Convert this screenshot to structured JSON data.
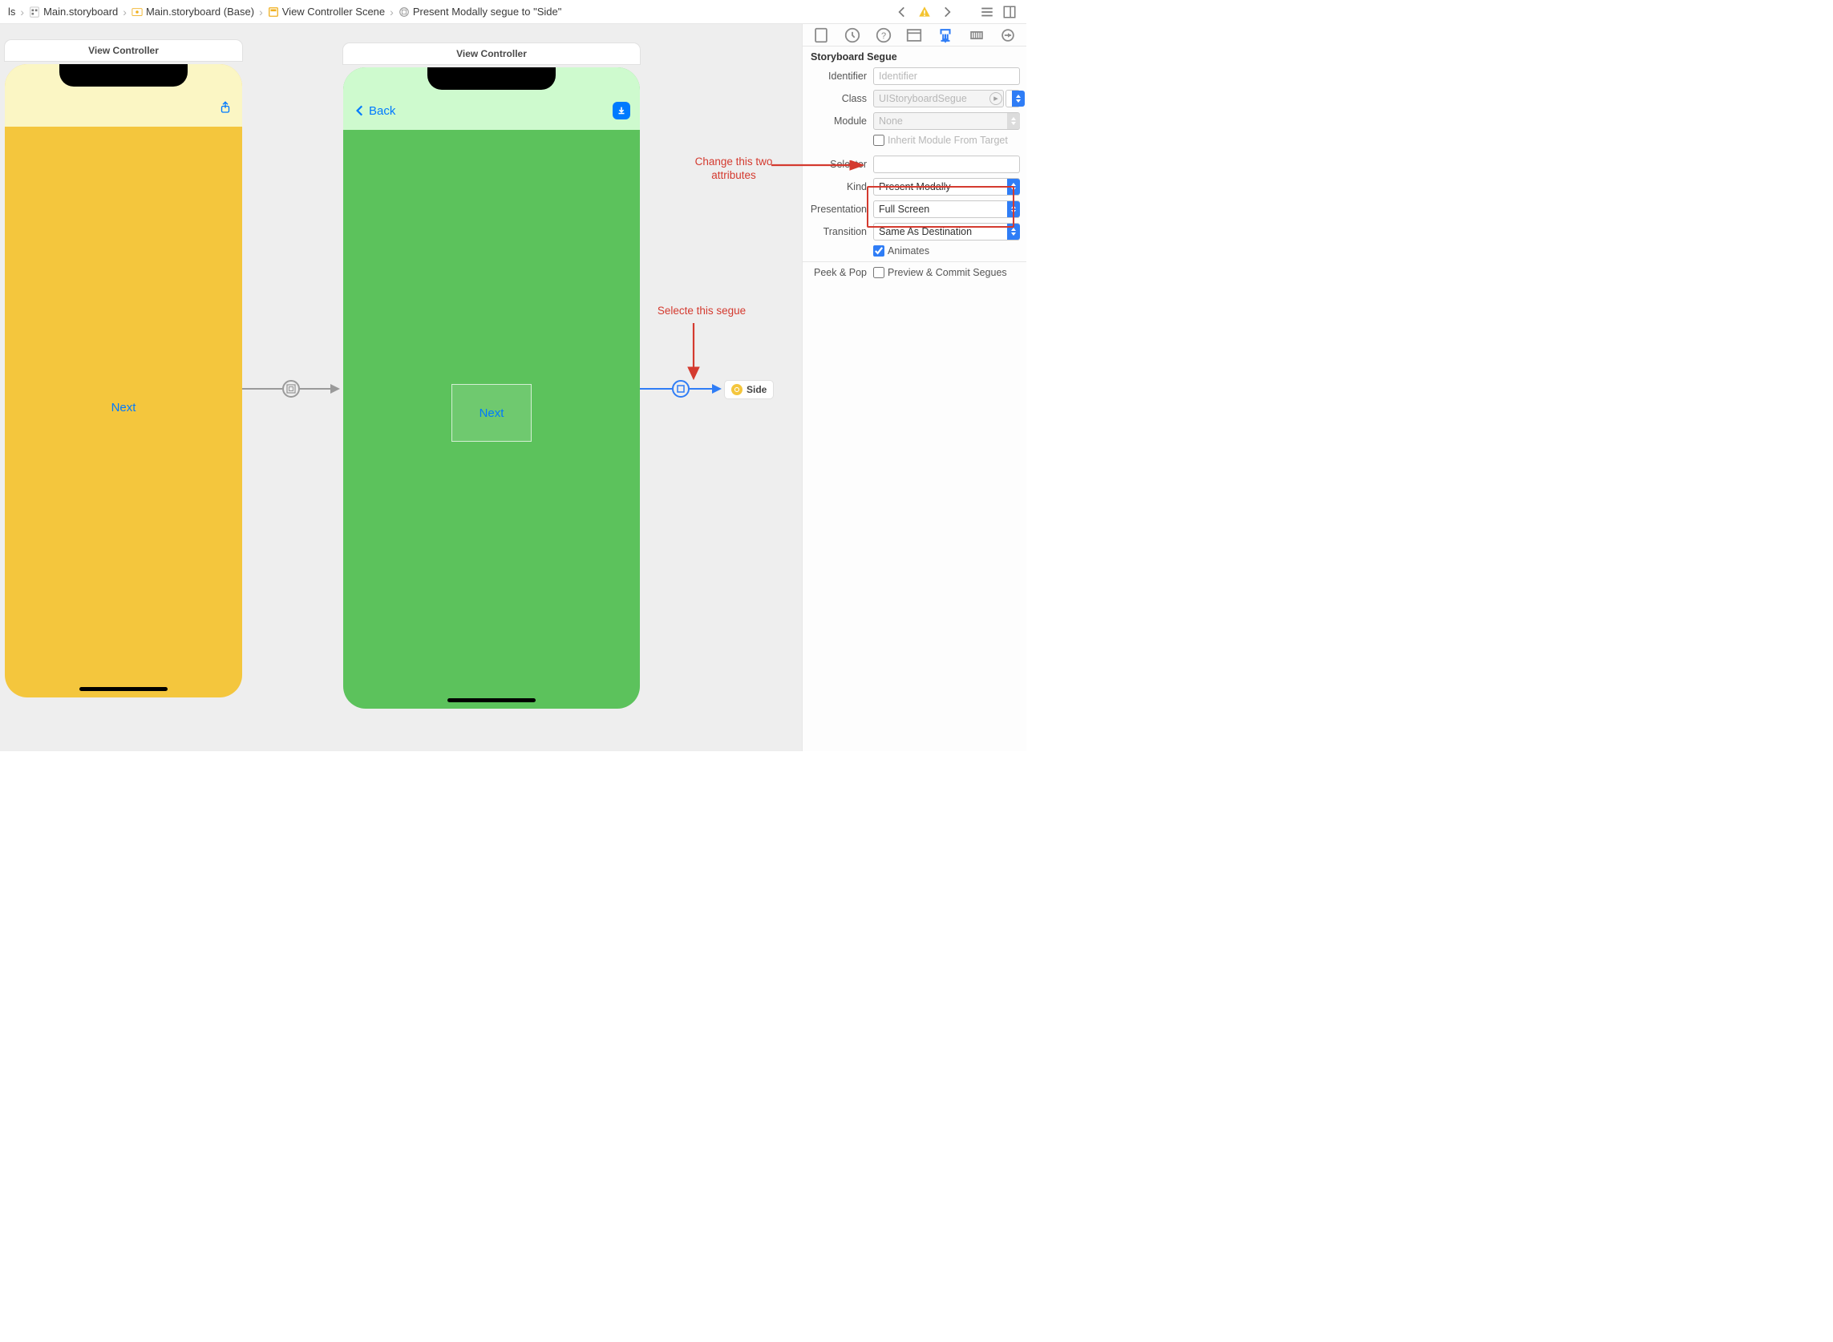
{
  "breadcrumb": {
    "item0_suffix": "ls",
    "item1": "Main.storyboard",
    "item2": "Main.storyboard (Base)",
    "item3": "View Controller Scene",
    "item4": "Present Modally segue to \"Side\""
  },
  "scenes": {
    "vc1_title": "View Controller",
    "vc2_title": "View Controller",
    "vc1_center_button": "Next",
    "vc2_back_label": "Back",
    "vc2_center_button": "Next",
    "side_chip": "Side"
  },
  "annotations": {
    "select_segue": "Selecte this segue",
    "change_attrs_line1": "Change this two",
    "change_attrs_line2": "attributes"
  },
  "inspector": {
    "header": "Storyboard Segue",
    "labels": {
      "identifier": "Identifier",
      "class": "Class",
      "module": "Module",
      "inherit": "Inherit Module From Target",
      "selector": "Selector",
      "kind": "Kind",
      "presentation": "Presentation",
      "transition": "Transition",
      "animates": "Animates",
      "peek": "Peek & Pop",
      "preview": "Preview & Commit Segues"
    },
    "values": {
      "identifier_placeholder": "Identifier",
      "class_placeholder": "UIStoryboardSegue",
      "module_placeholder": "None",
      "selector_value": "",
      "kind": "Present Modally",
      "presentation": "Full Screen",
      "transition": "Same As Destination",
      "animates_checked": true,
      "inherit_checked": false,
      "preview_checked": false
    }
  }
}
